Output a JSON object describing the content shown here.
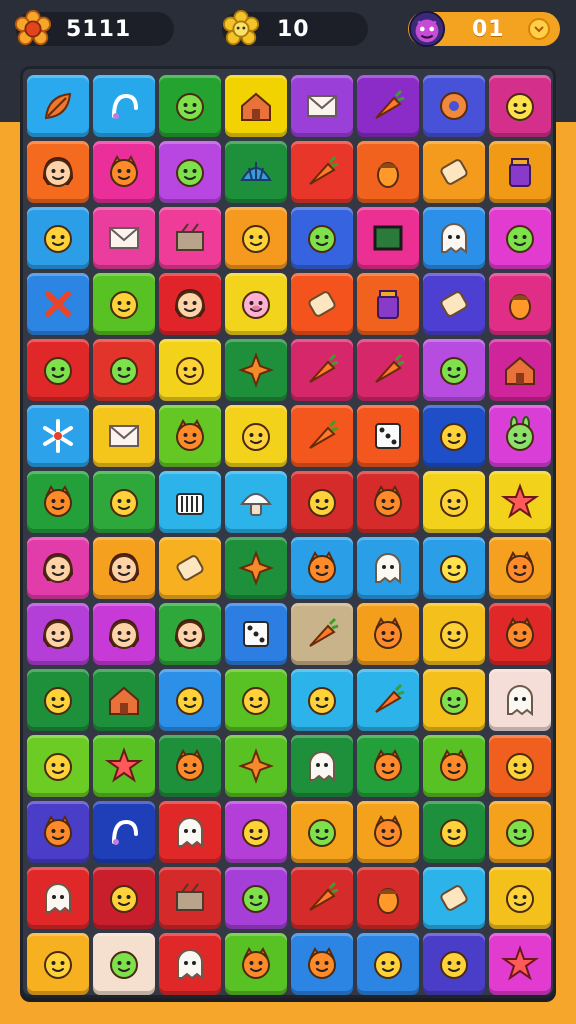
{
  "hud": {
    "score": {
      "value": "5111",
      "icon": "flower-badge-icon",
      "color": "#f6a62b"
    },
    "moves": {
      "value": "10",
      "icon": "flower-badge-icon",
      "color": "#f3c42a"
    },
    "level": {
      "value": "01",
      "icon": "monster-avatar-icon",
      "accent": "#f4a321"
    }
  },
  "board": {
    "rows": [
      [
        {
          "bg": "#2aa9ef",
          "icon": "leaf-icon"
        },
        {
          "bg": "#27a8ea",
          "icon": "hook-icon"
        },
        {
          "bg": "#25a330",
          "icon": "blob-face-icon"
        },
        {
          "bg": "#f2d200",
          "icon": "house-icon"
        },
        {
          "bg": "#9a3fd8",
          "icon": "envelope-icon"
        },
        {
          "bg": "#8b2cc8",
          "icon": "carrot-icon"
        },
        {
          "bg": "#4752d9",
          "icon": "donut-icon"
        },
        {
          "bg": "#d42f8a",
          "icon": "bulb-face-icon"
        }
      ],
      [
        {
          "bg": "#f46a1e",
          "icon": "girl-face-icon"
        },
        {
          "bg": "#ea2f9b",
          "icon": "cat-face-icon"
        },
        {
          "bg": "#b846e0",
          "icon": "blob-face-icon"
        },
        {
          "bg": "#1e8f3a",
          "icon": "shell-icon"
        },
        {
          "bg": "#e8372a",
          "icon": "carrot-icon"
        },
        {
          "bg": "#f0621e",
          "icon": "acorn-icon"
        },
        {
          "bg": "#f49a1c",
          "icon": "scroll-icon"
        },
        {
          "bg": "#f09a16",
          "icon": "jar-icon"
        }
      ],
      [
        {
          "bg": "#2c9ee8",
          "icon": "smile-face-icon"
        },
        {
          "bg": "#ea3d9e",
          "icon": "envelope-icon"
        },
        {
          "bg": "#ee3c98",
          "icon": "box-icon"
        },
        {
          "bg": "#f59a1e",
          "icon": "smile-face-icon"
        },
        {
          "bg": "#3664e0",
          "icon": "blob-face-icon"
        },
        {
          "bg": "#ec2f93",
          "icon": "chalkboard-icon"
        },
        {
          "bg": "#2c8fe8",
          "icon": "ghost-face-icon"
        },
        {
          "bg": "#e23bd0",
          "icon": "blob-face-icon"
        }
      ],
      [
        {
          "bg": "#2c84e3",
          "icon": "cross-icon"
        },
        {
          "bg": "#58c123",
          "icon": "smile-face-icon"
        },
        {
          "bg": "#e0242a",
          "icon": "girl-face-icon"
        },
        {
          "bg": "#f3d41c",
          "icon": "pig-face-icon"
        },
        {
          "bg": "#f4531e",
          "icon": "scroll-icon"
        },
        {
          "bg": "#f0621e",
          "icon": "jar-icon"
        },
        {
          "bg": "#4d3fd2",
          "icon": "scroll-icon"
        },
        {
          "bg": "#e02e86",
          "icon": "acorn-icon"
        }
      ],
      [
        {
          "bg": "#e02828",
          "icon": "blob-face-icon"
        },
        {
          "bg": "#e2342a",
          "icon": "blob-face-icon"
        },
        {
          "bg": "#f3d21c",
          "icon": "smile-face-icon"
        },
        {
          "bg": "#1e8f3a",
          "icon": "star-icon"
        },
        {
          "bg": "#d6276a",
          "icon": "carrot-icon"
        },
        {
          "bg": "#d6276a",
          "icon": "carrot-icon"
        },
        {
          "bg": "#b64de0",
          "icon": "blob-face-icon"
        },
        {
          "bg": "#d0249a",
          "icon": "house-icon"
        }
      ],
      [
        {
          "bg": "#2ca2ea",
          "icon": "snowflake-icon"
        },
        {
          "bg": "#f4c61c",
          "icon": "envelope-icon"
        },
        {
          "bg": "#64c724",
          "icon": "cat-face-icon"
        },
        {
          "bg": "#f3d21c",
          "icon": "smile-face-icon"
        },
        {
          "bg": "#f4571e",
          "icon": "carrot-icon"
        },
        {
          "bg": "#f4571e",
          "icon": "dice-icon"
        },
        {
          "bg": "#1f4fc8",
          "icon": "smile-face-icon"
        },
        {
          "bg": "#d93fd6",
          "icon": "bunny-face-icon"
        }
      ],
      [
        {
          "bg": "#23a03a",
          "icon": "cat-face-icon"
        },
        {
          "bg": "#2ea83a",
          "icon": "smile-face-icon"
        },
        {
          "bg": "#2bb3ea",
          "icon": "basket-icon"
        },
        {
          "bg": "#2bb3ea",
          "icon": "mushroom-icon"
        },
        {
          "bg": "#d62b2b",
          "icon": "smile-face-icon"
        },
        {
          "bg": "#d62b2b",
          "icon": "cat-face-icon"
        },
        {
          "bg": "#f3d21c",
          "icon": "smile-face-icon"
        },
        {
          "bg": "#f3d21c",
          "icon": "starfish-icon"
        }
      ],
      [
        {
          "bg": "#e23baa",
          "icon": "girl-face-icon"
        },
        {
          "bg": "#f6a020",
          "icon": "girl-face-icon"
        },
        {
          "bg": "#f6b020",
          "icon": "scroll-icon"
        },
        {
          "bg": "#1e8f3a",
          "icon": "star-icon"
        },
        {
          "bg": "#2b9ee8",
          "icon": "cat-face-icon"
        },
        {
          "bg": "#2b9ee8",
          "icon": "ghost-face-icon"
        },
        {
          "bg": "#2b9ee8",
          "icon": "bulb-face-icon"
        },
        {
          "bg": "#f6a020",
          "icon": "cat-face-icon"
        }
      ],
      [
        {
          "bg": "#b43fd8",
          "icon": "girl-face-icon"
        },
        {
          "bg": "#c83ad8",
          "icon": "girl-face-icon"
        },
        {
          "bg": "#2ea83a",
          "icon": "girl-face-icon"
        },
        {
          "bg": "#2c7ee3",
          "icon": "dice-icon"
        },
        {
          "bg": "#c9b38a",
          "icon": "carrot-icon"
        },
        {
          "bg": "#f49f1c",
          "icon": "cat-face-icon"
        },
        {
          "bg": "#f4c01c",
          "icon": "smile-face-icon"
        },
        {
          "bg": "#e02828",
          "icon": "cat-face-icon"
        }
      ],
      [
        {
          "bg": "#1e8f3a",
          "icon": "smile-face-icon"
        },
        {
          "bg": "#1e8f3a",
          "icon": "house-icon"
        },
        {
          "bg": "#2c8fe8",
          "icon": "smile-face-icon"
        },
        {
          "bg": "#58c123",
          "icon": "smile-face-icon"
        },
        {
          "bg": "#2bb3ea",
          "icon": "smile-face-icon"
        },
        {
          "bg": "#2bb3ea",
          "icon": "carrot-icon"
        },
        {
          "bg": "#f3c01c",
          "icon": "blob-face-icon"
        },
        {
          "bg": "#f5ddd8",
          "icon": "ghost-face-icon"
        }
      ],
      [
        {
          "bg": "#6ccc24",
          "icon": "smile-face-icon"
        },
        {
          "bg": "#58c123",
          "icon": "starfish-icon"
        },
        {
          "bg": "#1e8f3a",
          "icon": "cat-face-icon"
        },
        {
          "bg": "#58c123",
          "icon": "star-icon"
        },
        {
          "bg": "#1e8f3a",
          "icon": "ghost-face-icon"
        },
        {
          "bg": "#23a03a",
          "icon": "cat-face-icon"
        },
        {
          "bg": "#58c123",
          "icon": "cat-face-icon"
        },
        {
          "bg": "#f05f1e",
          "icon": "smile-face-icon"
        }
      ],
      [
        {
          "bg": "#4a3ec8",
          "icon": "cat-face-icon"
        },
        {
          "bg": "#1f3fb8",
          "icon": "hook-icon"
        },
        {
          "bg": "#e02828",
          "icon": "ghost-face-icon"
        },
        {
          "bg": "#b43fd8",
          "icon": "smile-face-icon"
        },
        {
          "bg": "#f4a21c",
          "icon": "blob-face-icon"
        },
        {
          "bg": "#f4a21c",
          "icon": "cat-face-icon"
        },
        {
          "bg": "#1e8f3a",
          "icon": "smile-face-icon"
        },
        {
          "bg": "#f4a21c",
          "icon": "blob-face-icon"
        }
      ],
      [
        {
          "bg": "#e02828",
          "icon": "ghost-face-icon"
        },
        {
          "bg": "#c91f2c",
          "icon": "smile-face-icon"
        },
        {
          "bg": "#d52a2a",
          "icon": "box-icon"
        },
        {
          "bg": "#a63fd8",
          "icon": "blob-face-icon"
        },
        {
          "bg": "#d62b2b",
          "icon": "carrot-icon"
        },
        {
          "bg": "#d62b2b",
          "icon": "acorn-icon"
        },
        {
          "bg": "#2bb3ea",
          "icon": "scroll-icon"
        },
        {
          "bg": "#f4c01c",
          "icon": "smile-face-icon"
        }
      ],
      [
        {
          "bg": "#f6b020",
          "icon": "smile-face-icon"
        },
        {
          "bg": "#f5e0d0",
          "icon": "blob-face-icon"
        },
        {
          "bg": "#e02828",
          "icon": "ghost-face-icon"
        },
        {
          "bg": "#58c123",
          "icon": "cat-face-icon"
        },
        {
          "bg": "#2c84e3",
          "icon": "cat-face-icon"
        },
        {
          "bg": "#2c84e3",
          "icon": "smile-face-icon"
        },
        {
          "bg": "#4a3ec8",
          "icon": "smile-face-icon"
        },
        {
          "bg": "#e23bd0",
          "icon": "starfish-icon"
        }
      ]
    ]
  }
}
